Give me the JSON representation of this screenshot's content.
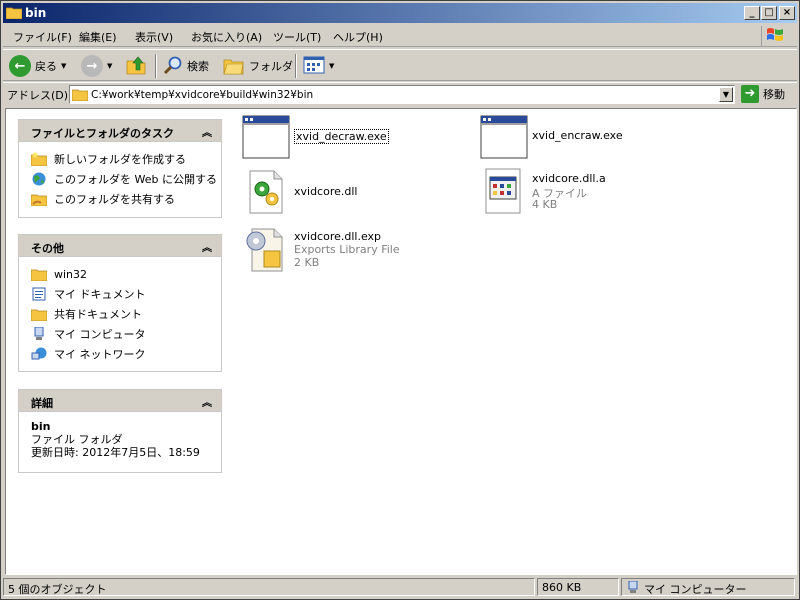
{
  "window": {
    "title": "bin",
    "buttons": {
      "minimize": "_",
      "maximize": "□",
      "close": "×"
    }
  },
  "menu": [
    "ファイル(F)",
    "編集(E)",
    "表示(V)",
    "お気に入り(A)",
    "ツール(T)",
    "ヘルプ(H)"
  ],
  "toolbar": {
    "back_label": "戻る",
    "search_label": "検索",
    "folders_label": "フォルダ"
  },
  "address": {
    "label": "アドレス(D)",
    "value": "C:¥work¥temp¥xvidcore¥build¥win32¥bin",
    "go_label": "移動"
  },
  "tasks_panel": {
    "title": "ファイルとフォルダのタスク",
    "items": [
      {
        "label": "新しいフォルダを作成する",
        "icon": "new-folder-icon"
      },
      {
        "label": "このフォルダを Web に公開する",
        "icon": "web-publish-icon"
      },
      {
        "label": "このフォルダを共有する",
        "icon": "share-folder-icon"
      }
    ]
  },
  "other_panel": {
    "title": "その他",
    "items": [
      {
        "label": "win32",
        "icon": "folder-icon"
      },
      {
        "label": "マイ ドキュメント",
        "icon": "my-documents-icon"
      },
      {
        "label": "共有ドキュメント",
        "icon": "shared-documents-icon"
      },
      {
        "label": "マイ コンピュータ",
        "icon": "my-computer-icon"
      },
      {
        "label": "マイ ネットワーク",
        "icon": "my-network-icon"
      }
    ]
  },
  "details_panel": {
    "title": "詳細",
    "name": "bin",
    "type": "ファイル フォルダ",
    "modified": "更新日時: 2012年7月5日、18:59"
  },
  "files": [
    {
      "name": "xvid_decraw.exe",
      "sub1": "",
      "sub2": "",
      "icon": "exe-window-icon"
    },
    {
      "name": "xvid_encraw.exe",
      "sub1": "",
      "sub2": "",
      "icon": "exe-window-icon"
    },
    {
      "name": "xvidcore.dll",
      "sub1": "",
      "sub2": "",
      "icon": "dll-gear-icon"
    },
    {
      "name": "xvidcore.dll.a",
      "sub1": "A ファイル",
      "sub2": "4 KB",
      "icon": "generic-file-icon"
    },
    {
      "name": "xvidcore.dll.exp",
      "sub1": "Exports Library File",
      "sub2": "2 KB",
      "icon": "exp-gear-file-icon"
    }
  ],
  "status": {
    "objects": "5 個のオブジェクト",
    "size": "860 KB",
    "location": "マイ コンピューター"
  },
  "colors": {
    "titlebar_start": "#0a246a",
    "titlebar_end": "#a6caf0",
    "chrome": "#d4d0c8",
    "folder": "#f5c542"
  }
}
